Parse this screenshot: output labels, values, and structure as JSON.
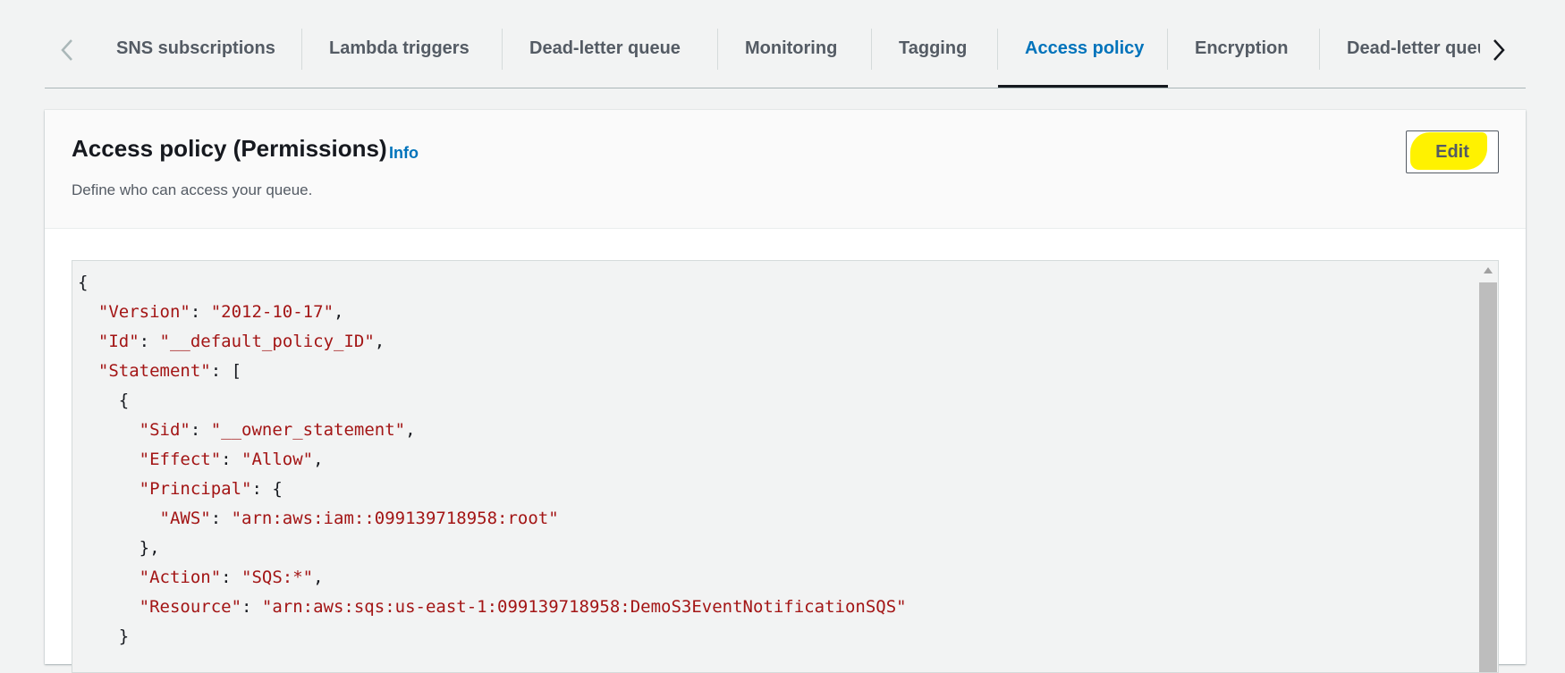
{
  "tabs": [
    {
      "label": "SNS subscriptions",
      "active": false
    },
    {
      "label": "Lambda triggers",
      "active": false
    },
    {
      "label": "Dead-letter queue",
      "active": false
    },
    {
      "label": "Monitoring",
      "active": false
    },
    {
      "label": "Tagging",
      "active": false
    },
    {
      "label": "Access policy",
      "active": true
    },
    {
      "label": "Encryption",
      "active": false
    },
    {
      "label": "Dead-letter queue redrive status",
      "active": false
    }
  ],
  "tab_icons": {
    "left": "chevron-left-icon",
    "right": "chevron-right-icon"
  },
  "panel": {
    "title": "Access policy (Permissions)",
    "info_label": "Info",
    "description": "Define who can access your queue.",
    "edit_label": "Edit"
  },
  "policy": {
    "version_key": "\"Version\"",
    "version_value": "\"2012-10-17\"",
    "id_key": "\"Id\"",
    "id_value": "\"__default_policy_ID\"",
    "statement_key": "\"Statement\"",
    "sid_key": "\"Sid\"",
    "sid_value": "\"__owner_statement\"",
    "effect_key": "\"Effect\"",
    "effect_value": "\"Allow\"",
    "principal_key": "\"Principal\"",
    "aws_key": "\"AWS\"",
    "aws_value": "\"arn:aws:iam::099139718958:root\"",
    "action_key": "\"Action\"",
    "action_value": "\"SQS:*\"",
    "resource_key": "\"Resource\"",
    "resource_value": "\"arn:aws:sqs:us-east-1:099139718958:DemoS3EventNotificationSQS\""
  },
  "colors": {
    "active_tab": "#0073bb",
    "json_string": "#a31515",
    "highlight": "#fff200",
    "page_background": "#f2f3f3"
  }
}
